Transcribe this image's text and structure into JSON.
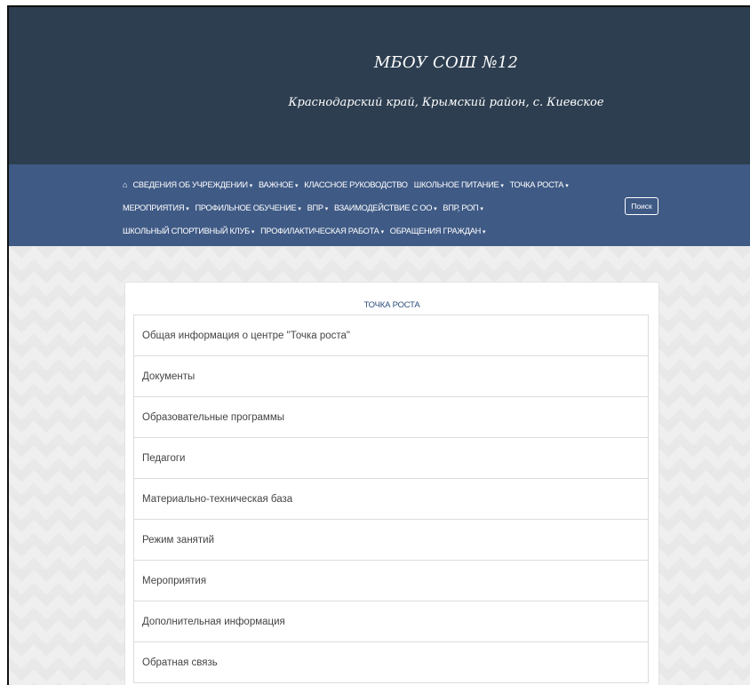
{
  "header": {
    "school_name": "МБОУ СОШ №12",
    "address": "Краснодарский край, Крымский район, с. Киевское"
  },
  "nav": {
    "rows": [
      [
        {
          "label": "СВЕДЕНИЯ ОБ УЧРЕЖДЕНИИ",
          "dropdown": true
        },
        {
          "label": "ВАЖНОЕ",
          "dropdown": true
        },
        {
          "label": "КЛАССНОЕ РУКОВОДСТВО",
          "dropdown": false
        },
        {
          "label": "ШКОЛЬНОЕ ПИТАНИЕ",
          "dropdown": true
        },
        {
          "label": "ТОЧКА РОСТА",
          "dropdown": true
        }
      ],
      [
        {
          "label": "МЕРОПРИЯТИЯ",
          "dropdown": true
        },
        {
          "label": "ПРОФИЛЬНОЕ ОБУЧЕНИЕ",
          "dropdown": true
        },
        {
          "label": "ВПР",
          "dropdown": true
        },
        {
          "label": "ВЗАИМОДЕЙСТВИЕ С ОО",
          "dropdown": true
        },
        {
          "label": "ВПР, РОП",
          "dropdown": true
        }
      ],
      [
        {
          "label": "ШКОЛЬНЫЙ СПОРТИВНЫЙ КЛУБ",
          "dropdown": true
        },
        {
          "label": "ПРОФИЛАКТИЧЕСКАЯ РАБОТА",
          "dropdown": true
        },
        {
          "label": "ОБРАЩЕНИЯ ГРАЖДАН",
          "dropdown": true
        }
      ]
    ],
    "search_label": "Поиск",
    "home_icon": "home-icon"
  },
  "card": {
    "title": "ТОЧКА РОСТА",
    "items": [
      "Общая информация о центре \"Точка роста\"",
      "Документы",
      "Образовательные программы",
      "Педагоги",
      "Материально-техническая база",
      "Режим занятий",
      "Мероприятия",
      "Дополнительная информация",
      "Обратная связь"
    ]
  },
  "colors": {
    "header_bg": "#2d3e50",
    "nav_bg": "#3f5a85",
    "card_title": "#2d4f7c"
  }
}
